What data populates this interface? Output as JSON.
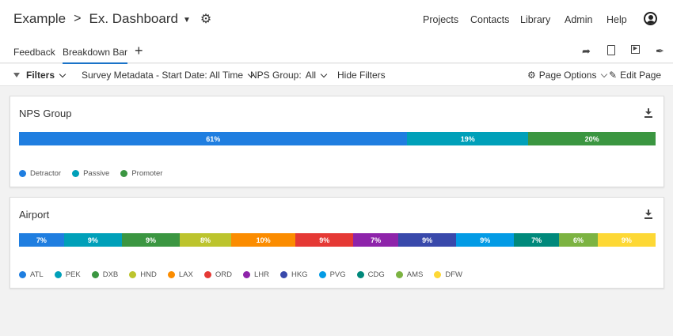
{
  "header": {
    "breadcrumb_root": "Example",
    "breadcrumb_sep": ">",
    "dashboard_name": "Ex. Dashboard",
    "nav": [
      "Projects",
      "Contacts",
      "Library",
      "Admin",
      "Help"
    ]
  },
  "tabs": {
    "feedback": "Feedback",
    "breakdown": "Breakdown Bar",
    "add": "+"
  },
  "filters": {
    "label": "Filters",
    "survey": "Survey Metadata - Start Date: All Time",
    "nps_label": "NPS Group:",
    "nps_value": "All",
    "hide": "Hide Filters",
    "page_options": "Page Options",
    "edit_page": "Edit Page"
  },
  "chart_data": [
    {
      "type": "bar",
      "title": "NPS Group",
      "categories": [
        "Detractor",
        "Passive",
        "Promoter"
      ],
      "values": [
        61,
        19,
        20
      ],
      "labels": [
        "61%",
        "19%",
        "20%"
      ],
      "colors": [
        "#1f7ee0",
        "#00a0b9",
        "#3b9641"
      ],
      "legend": "bottom-left"
    },
    {
      "type": "bar",
      "title": "Airport",
      "categories": [
        "ATL",
        "PEK",
        "DXB",
        "HND",
        "LAX",
        "ORD",
        "LHR",
        "HKG",
        "PVG",
        "CDG",
        "AMS",
        "DFW"
      ],
      "values": [
        7,
        9,
        9,
        8,
        10,
        9,
        7,
        9,
        9,
        7,
        6,
        9
      ],
      "labels": [
        "7%",
        "9%",
        "9%",
        "8%",
        "10%",
        "9%",
        "7%",
        "9%",
        "9%",
        "7%",
        "6%",
        "9%"
      ],
      "colors": [
        "#1f7ee0",
        "#00a0b9",
        "#3b9641",
        "#bcc42d",
        "#fb8c00",
        "#e53935",
        "#8e24aa",
        "#3949ab",
        "#039be5",
        "#00897b",
        "#7cb342",
        "#fdd835"
      ],
      "legend": "bottom-left"
    }
  ]
}
